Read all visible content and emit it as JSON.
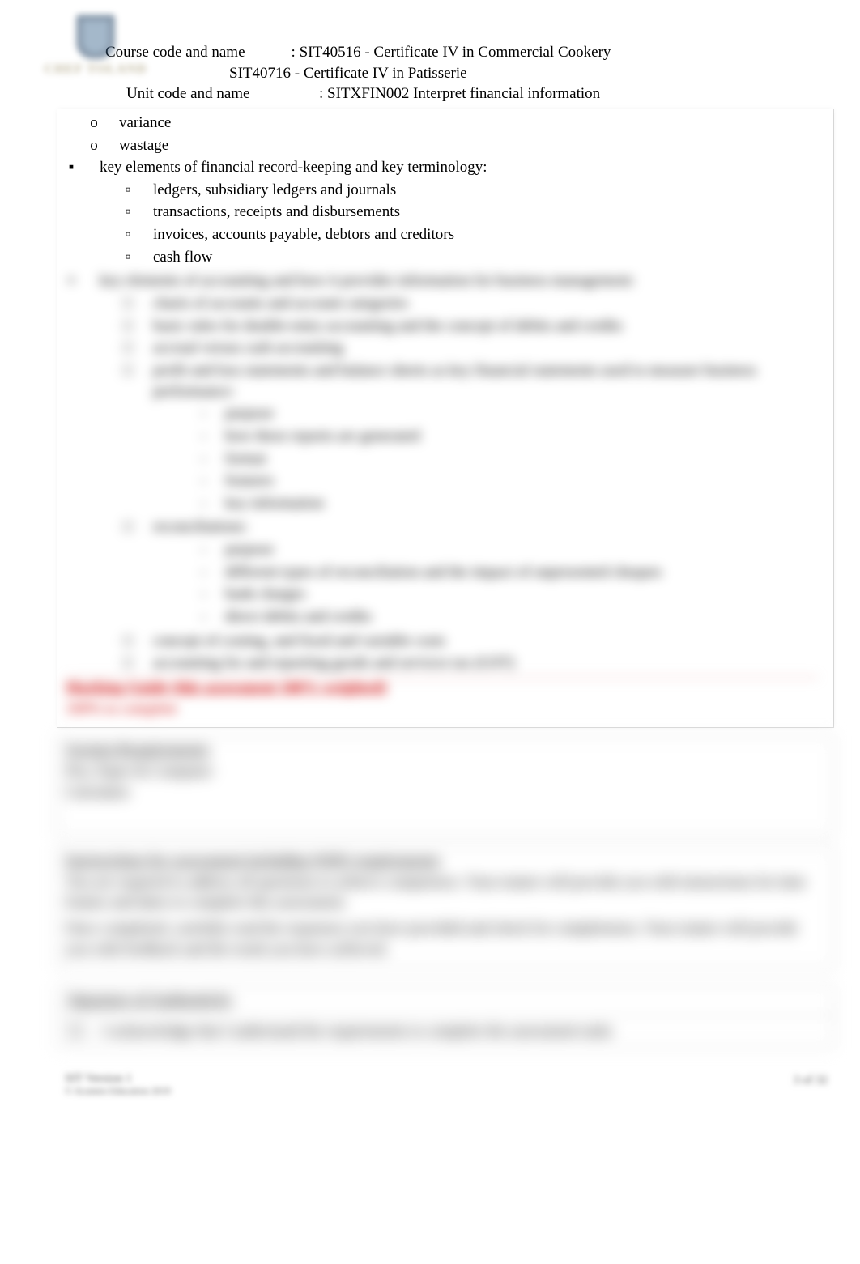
{
  "logo": {
    "brand_text": "CHEF TOLAND"
  },
  "header": {
    "course_label": "Course code and name",
    "course_sep": ":",
    "course_val_1": "SIT40516 - Certificate IV in Commercial Cookery",
    "course_val_2": "SIT40716 - Certificate IV in Patisserie",
    "unit_label": "Unit code and name",
    "unit_sep": ":",
    "unit_val": "SITXFIN002 Interpret financial information"
  },
  "visible": {
    "sub_o_items": [
      "variance",
      "wastage"
    ],
    "bullet_1": "key elements of financial record-keeping and key terminology:",
    "sub_sq_items": [
      "ledgers, subsidiary ledgers and journals",
      "transactions, receipts and disbursements",
      "invoices, accounts payable, debtors and creditors",
      "cash flow"
    ]
  },
  "blurred": {
    "bullet_2": "key elements of accounting and how it provides information for business management:",
    "sub_sq_items_2": [
      "charts of accounts and account categories",
      "basic rules for double-entry accounting and the concept of debits and credits",
      "accrual versus cash accounting",
      "profit and loss statements and balance sheets as key financial statements used to measure business performance:"
    ],
    "sub_sub_items_a": [
      "purpose",
      "how these reports are generated",
      "format",
      "features",
      "key information"
    ],
    "sub_sq_item_recon": "reconciliations:",
    "sub_sub_items_b": [
      "purpose",
      "different types of reconciliation and the impact of unpresented cheques",
      "bank charges",
      "direct debits and credits"
    ],
    "sub_sq_tail": [
      "concept of costing, and fixed and variable costs",
      "accounting for and reporting goods and services tax (GST)"
    ],
    "red_heading": "Marking Guide (this assessment 100% weighted)",
    "red_sub": "100% to complete",
    "sec2_heading": "Session Requirements",
    "sec2_line1": "Pen, Paper & Computer",
    "sec2_line2": "Calculator",
    "sec3_heading": "Instructions for assessment including WHS requirements",
    "sec3_line1": "You are required to address all questions to achieve competence. Your trainer will provide you with instructions for time frames and dates to complete this assessment.",
    "sec3_line2": "Once completed, carefully read the responses you have provided and check for completeness. Your trainer will provide you with feedback and the result you have achieved.",
    "sig_heading": "Signature of Authenticity",
    "sig_text": "I acknowledge that I understand the requirements to complete the assessment tasks",
    "footer_left_1": "SIT Version 1",
    "footer_left_2": "© Acumen Education 2019",
    "footer_right": "3 of 32"
  }
}
